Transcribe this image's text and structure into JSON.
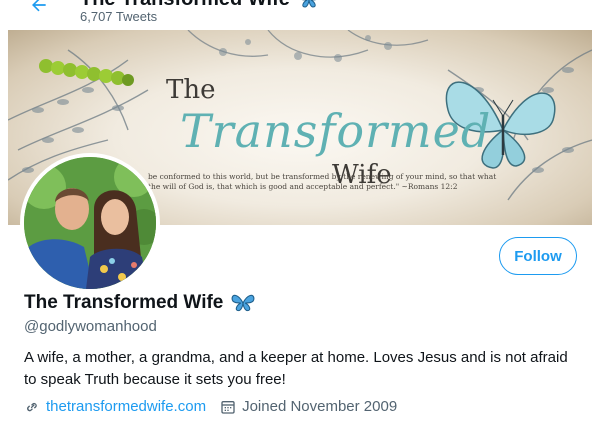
{
  "header": {
    "title": "The Transformed Wife",
    "tweet_count": "6,707 Tweets",
    "back_icon": "arrow-left-icon"
  },
  "banner": {
    "line_the": "The",
    "line_transformed": "Transformed",
    "line_wife": "Wife",
    "verse": "be conformed to this world, but be transformed by the renewing of your mind, so that what the will of God is, that which is good and acceptable and perfect.\" ~Romans 12:2"
  },
  "profile": {
    "name": "The Transformed Wife",
    "handle": "@godlywomanhood",
    "bio": "A wife, a mother, a grandma, and a keeper at home. Loves Jesus and is not afraid to speak Truth because it sets you free!",
    "website": "thetransformedwife.com",
    "joined": "Joined November 2009",
    "name_emoji_icon": "butterfly-icon"
  },
  "actions": {
    "follow_label": "Follow"
  },
  "colors": {
    "accent": "#1d9bf0",
    "secondary_text": "#536471",
    "butterfly": "#2f89c5"
  }
}
